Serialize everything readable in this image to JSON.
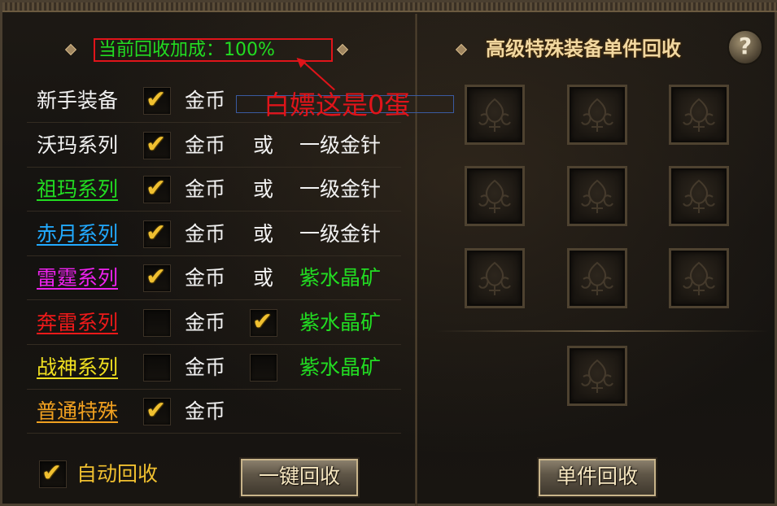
{
  "left_panel": {
    "bonus_text": "当前回收加成：100%",
    "annotation": "白嫖这是0蛋",
    "rows": [
      {
        "label": "新手装备",
        "label_color": "#f2f2f2",
        "underline": false,
        "coin_checked": true,
        "coin": "金币",
        "or": "",
        "alt": "",
        "alt_color": "#f2f2f2",
        "alt_checkbox": false,
        "alt_checked": false
      },
      {
        "label": "沃玛系列",
        "label_color": "#f2f2f2",
        "underline": false,
        "coin_checked": true,
        "coin": "金币",
        "or": "或",
        "alt": "一级金针",
        "alt_color": "#f2f2f2",
        "alt_checkbox": false,
        "alt_checked": false
      },
      {
        "label": "祖玛系列",
        "label_color": "#22dd22",
        "underline": true,
        "coin_checked": true,
        "coin": "金币",
        "or": "或",
        "alt": "一级金针",
        "alt_color": "#f2f2f2",
        "alt_checkbox": false,
        "alt_checked": false
      },
      {
        "label": "赤月系列",
        "label_color": "#22aaff",
        "underline": true,
        "coin_checked": true,
        "coin": "金币",
        "or": "或",
        "alt": "一级金针",
        "alt_color": "#f2f2f2",
        "alt_checkbox": false,
        "alt_checked": false
      },
      {
        "label": "雷霆系列",
        "label_color": "#ee22ee",
        "underline": true,
        "coin_checked": true,
        "coin": "金币",
        "or": "或",
        "alt": "紫水晶矿",
        "alt_color": "#22dd22",
        "alt_checkbox": false,
        "alt_checked": false
      },
      {
        "label": "奔雷系列",
        "label_color": "#ee1a1a",
        "underline": true,
        "coin_checked": false,
        "coin": "金币",
        "or": "",
        "alt": "紫水晶矿",
        "alt_color": "#22dd22",
        "alt_checkbox": true,
        "alt_checked": true
      },
      {
        "label": "战神系列",
        "label_color": "#f0e020",
        "underline": true,
        "coin_checked": false,
        "coin": "金币",
        "or": "",
        "alt": "紫水晶矿",
        "alt_color": "#22dd22",
        "alt_checkbox": true,
        "alt_checked": false
      },
      {
        "label": "普通特殊",
        "label_color": "#f0a020",
        "underline": true,
        "coin_checked": true,
        "coin": "金币",
        "or": "",
        "alt": "",
        "alt_color": "#f2f2f2",
        "alt_checkbox": false,
        "alt_checked": false
      }
    ],
    "auto_recycle": {
      "label": "自动回收",
      "checked": true
    },
    "one_click_button": "一键回收"
  },
  "right_panel": {
    "title": "高级特殊装备单件回收",
    "help_icon": "?",
    "slot_count": 9,
    "single_slot_count": 1,
    "single_button": "单件回收"
  },
  "colors": {
    "check": "#f0c030",
    "bonus": "#22dd22",
    "annotation": "#e0141a"
  }
}
